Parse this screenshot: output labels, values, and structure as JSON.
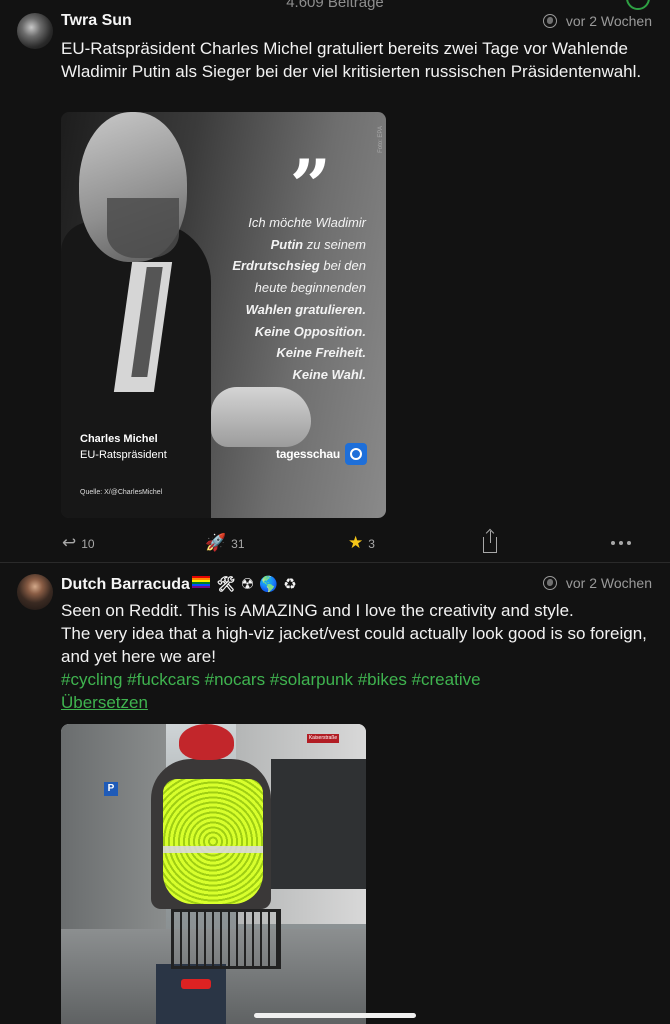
{
  "header": {
    "post_count": "4.609 Beiträge"
  },
  "posts": [
    {
      "author": "Twra Sun",
      "time": "vor 2 Wochen",
      "text": "EU-Ratspräsident Charles Michel gratuliert bereits zwei Tage vor Wahlende Wladimir Putin als Sieger bei der viel kritisierten russischen Präsidentenwahl.",
      "image": {
        "quote_mark": "”",
        "quote_lines": [
          {
            "text": "Ich möchte Wladimir",
            "bold": false
          },
          {
            "text_bold": "Putin",
            "text_rest": " zu seinem"
          },
          {
            "text_bold": "Erdrutschsieg",
            "text_rest": " bei den"
          },
          {
            "text": "heute beginnenden",
            "bold": false
          },
          {
            "text": "Wahlen gratulieren.",
            "bold": true
          },
          {
            "text": "Keine Opposition.",
            "bold": true
          },
          {
            "text": "Keine Freiheit.",
            "bold": true
          },
          {
            "text": "Keine Wahl.",
            "bold": true
          }
        ],
        "caption_name": "Charles Michel",
        "caption_role": "EU-Ratspräsident",
        "brand": "tagesschau",
        "source": "Quelle: X/@CharlesMichel",
        "credit": "Foto: EPA"
      },
      "actions": {
        "replies": "10",
        "boosts": "31",
        "favourites": "3"
      }
    },
    {
      "author": "Dutch Barracuda",
      "author_emojis": "🛠 ☢ 🌎 ♻",
      "time": "vor 2 Wochen",
      "text_line1": "Seen on Reddit. This is AMAZING and I love the creativity and style.",
      "text_line2": "The very idea that a high-viz jacket/vest could actually look good is so foreign, and yet here we are!",
      "hashtags": "#cycling #fuckcars #nocars #solarpunk #bikes #creative",
      "translate_label": "Übersetzen",
      "image": {
        "street_sign": "Kaiserstraße",
        "parking_sign": "P"
      }
    }
  ],
  "icons": {
    "visibility": "globe-icon",
    "reply": "reply-icon",
    "boost": "boost-icon",
    "favourite": "star-icon",
    "share": "share-icon",
    "more": "more-icon"
  },
  "colors": {
    "accent": "#3fb34f",
    "background": "#121212",
    "star": "#f5c518"
  }
}
